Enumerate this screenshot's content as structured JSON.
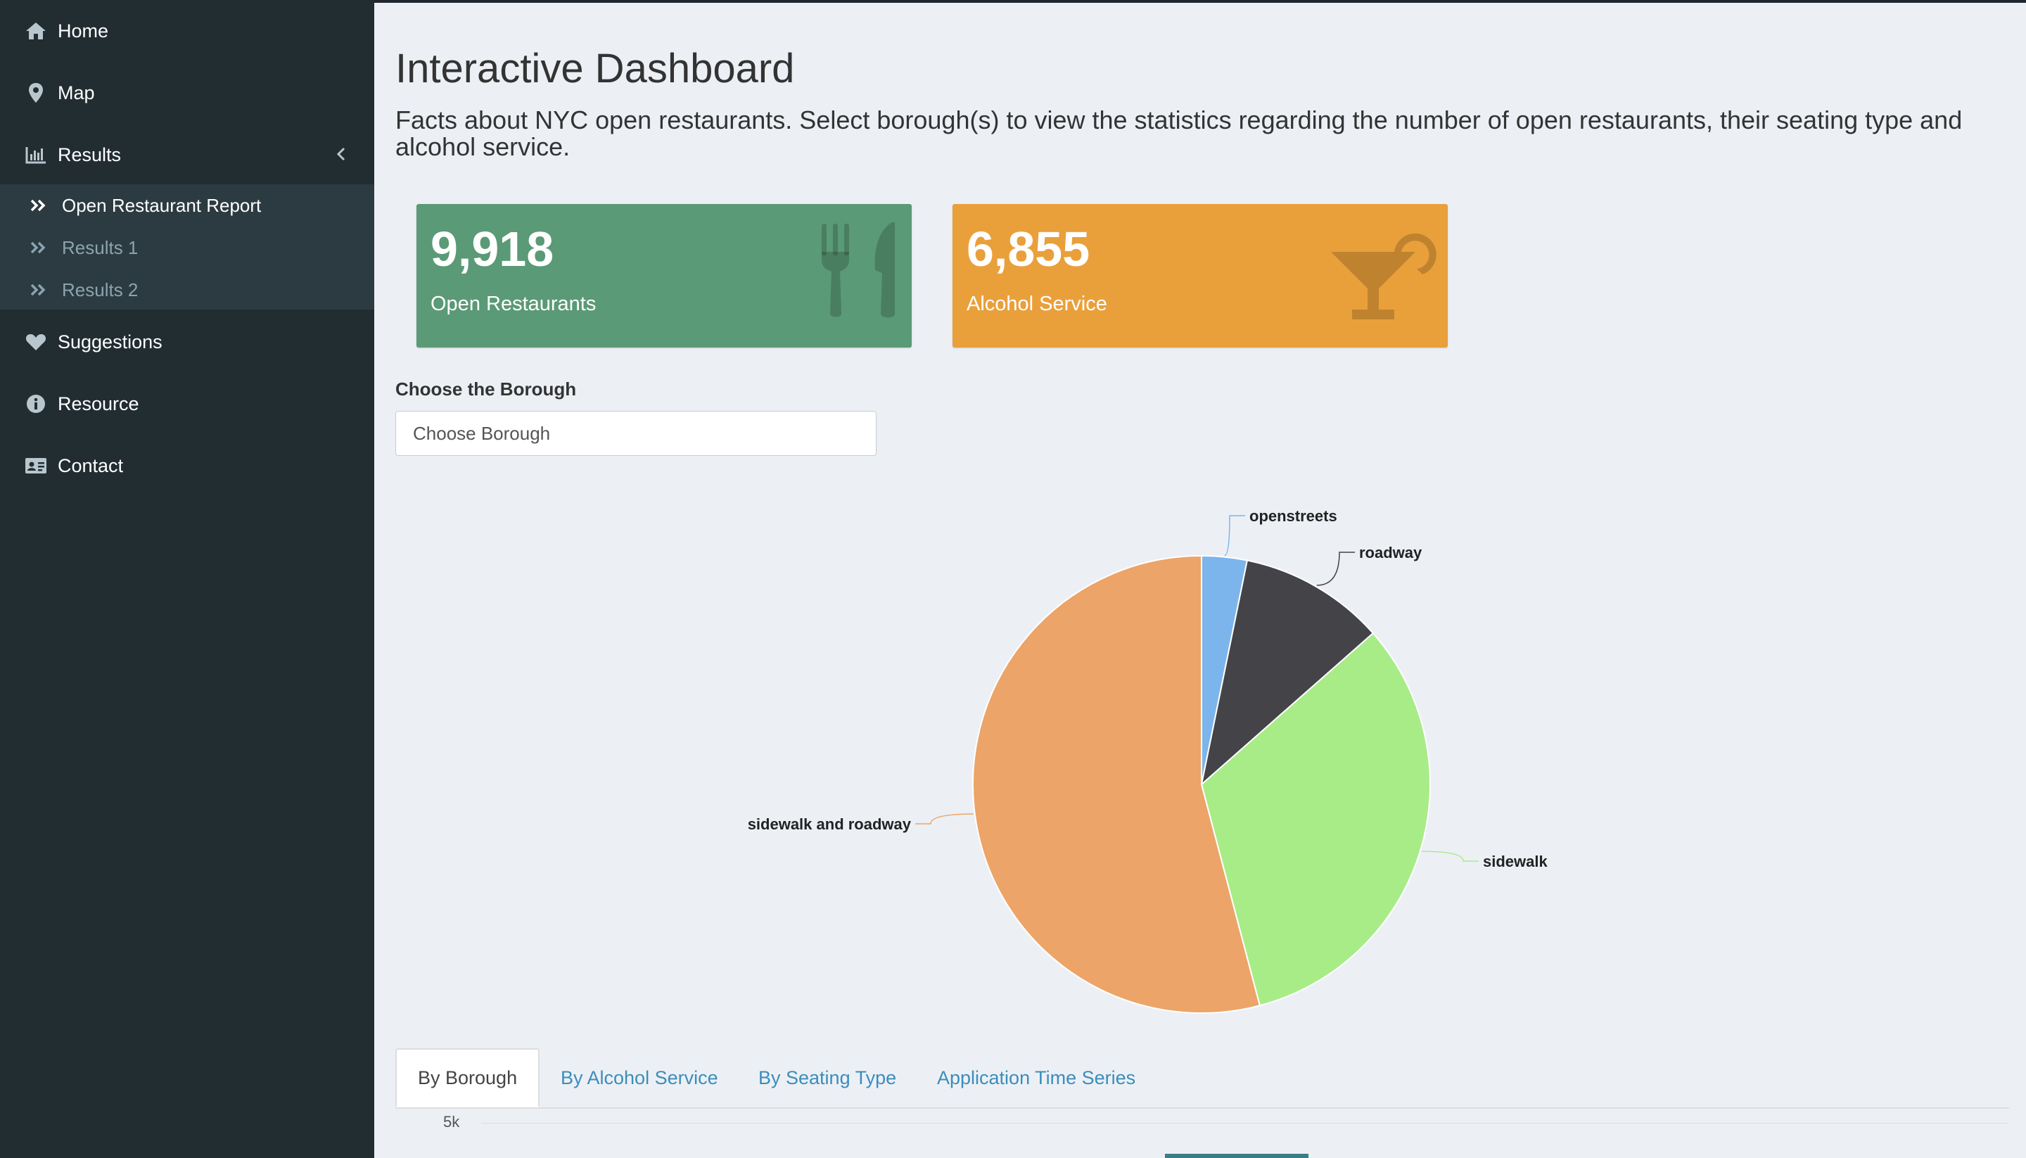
{
  "sidebar": {
    "items": [
      {
        "label": "Home",
        "icon": "home-icon"
      },
      {
        "label": "Map",
        "icon": "map-marker-icon"
      },
      {
        "label": "Results",
        "icon": "bar-chart-icon"
      },
      {
        "label": "Suggestions",
        "icon": "heart-icon"
      },
      {
        "label": "Resource",
        "icon": "info-circle-icon"
      },
      {
        "label": "Contact",
        "icon": "id-card-icon"
      }
    ],
    "results_submenu": [
      {
        "label": "Open Restaurant Report",
        "active": true
      },
      {
        "label": "Results 1",
        "active": false
      },
      {
        "label": "Results 2",
        "active": false
      }
    ]
  },
  "main": {
    "title": "Interactive Dashboard",
    "description": "Facts about NYC open restaurants. Select borough(s) to view the statistics regarding the number of open restaurants, their seating type and alcohol service.",
    "value_boxes": [
      {
        "value": "9,918",
        "caption": "Open Restaurants",
        "color": "#5a9a76",
        "icon": "cutlery-icon"
      },
      {
        "value": "6,855",
        "caption": "Alcohol Service",
        "color": "#e9a03b",
        "icon": "cocktail-icon"
      }
    ],
    "borough_select": {
      "label": "Choose the Borough",
      "placeholder": "Choose Borough"
    },
    "tabs": [
      {
        "label": "By Borough",
        "active": true
      },
      {
        "label": "By Alcohol Service",
        "active": false
      },
      {
        "label": "By Seating Type",
        "active": false
      },
      {
        "label": "Application Time Series",
        "active": false
      }
    ],
    "lower_chart_tick": "5k"
  },
  "chart_data": {
    "type": "pie",
    "categories": [
      "openstreets",
      "roadway",
      "sidewalk",
      "sidewalk and roadway"
    ],
    "values": [
      3.2,
      10.3,
      32.4,
      54.1
    ],
    "colors": [
      "#7cb5ec",
      "#434348",
      "#a8ec88",
      "#eca468"
    ]
  }
}
